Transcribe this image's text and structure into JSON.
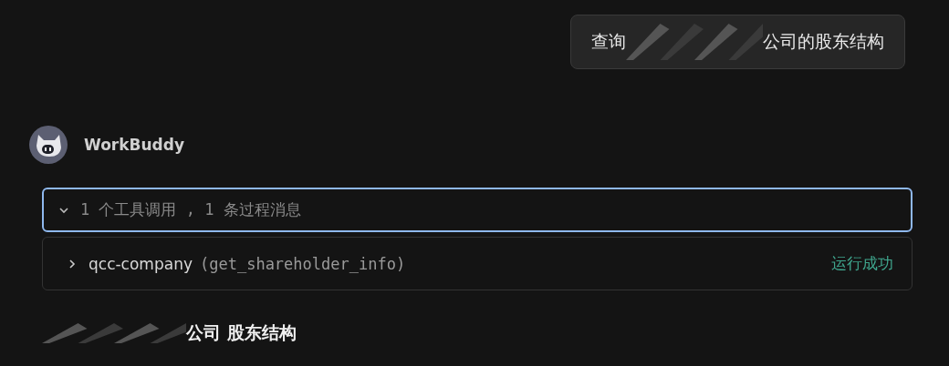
{
  "user_message": {
    "before": "查询",
    "after": "公司的股东结构",
    "redacted": true
  },
  "assistant": {
    "name": "WorkBuddy"
  },
  "process_summary": {
    "text": "1 个工具调用 , 1 条过程消息",
    "expanded": true,
    "focused": true
  },
  "tool_calls": [
    {
      "server": "qcc-company",
      "call": "(get_shareholder_info)",
      "status": "运行成功",
      "expanded": false
    }
  ],
  "heading": {
    "redacted": true,
    "text": "公司 股东结构"
  }
}
